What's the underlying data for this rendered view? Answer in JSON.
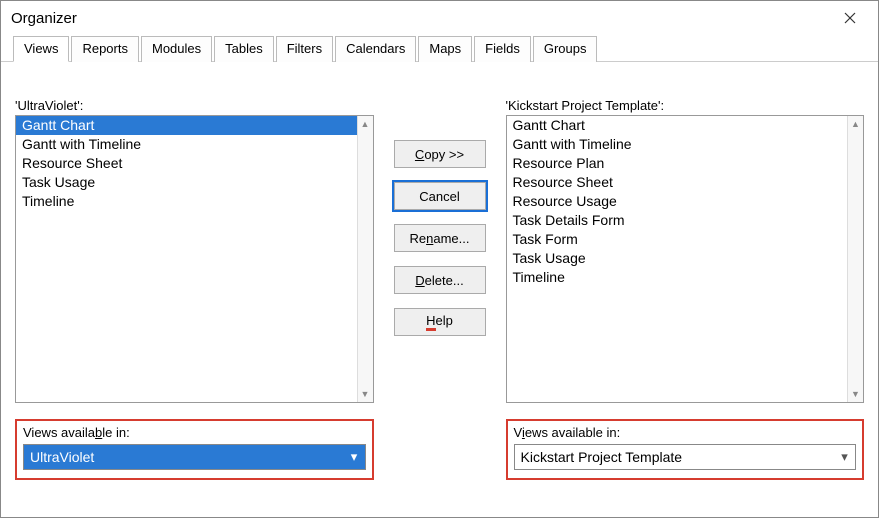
{
  "window": {
    "title": "Organizer"
  },
  "tabs": [
    "Views",
    "Reports",
    "Modules",
    "Tables",
    "Filters",
    "Calendars",
    "Maps",
    "Fields",
    "Groups"
  ],
  "activeTab": 0,
  "left": {
    "label": "'UltraViolet':",
    "items": [
      "Gantt Chart",
      "Gantt with Timeline",
      "Resource Sheet",
      "Task Usage",
      "Timeline"
    ],
    "selectedIndex": 0,
    "availLabel": "Views available in:",
    "availValue": "UltraViolet"
  },
  "right": {
    "label": "'Kickstart Project Template':",
    "items": [
      "Gantt Chart",
      "Gantt with Timeline",
      "Resource Plan",
      "Resource Sheet",
      "Resource Usage",
      "Task Details Form",
      "Task Form",
      "Task Usage",
      "Timeline"
    ],
    "availLabel": "Views available in:",
    "availValue": "Kickstart Project Template"
  },
  "buttons": {
    "copy": "Copy >>",
    "cancel": "Cancel",
    "rename": "Rename...",
    "delete": "Delete...",
    "help": "Help"
  }
}
